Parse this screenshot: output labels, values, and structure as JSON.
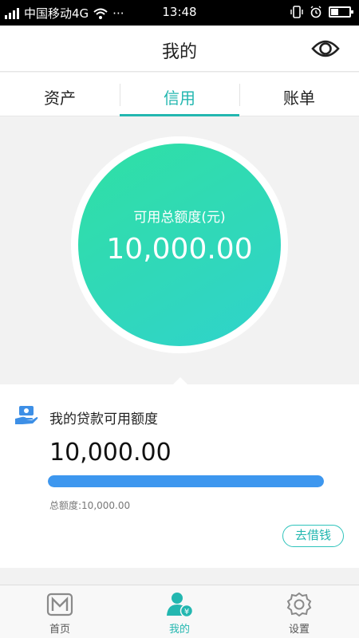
{
  "status_bar": {
    "carrier": "中国移动4G",
    "more": "···",
    "time": "13:48",
    "battery_level": 0.4
  },
  "header": {
    "title": "我的",
    "eye_icon": "eye-icon"
  },
  "tabs": [
    {
      "label": "资产",
      "active": false
    },
    {
      "label": "信用",
      "active": true
    },
    {
      "label": "账单",
      "active": false
    }
  ],
  "credit": {
    "label": "可用总额度(元)",
    "amount": "10,000.00"
  },
  "loan": {
    "title": "我的贷款可用额度",
    "amount": "10,000.00",
    "progress": 1.0,
    "total_text": "总额度:10,000.00",
    "borrow_button": "去借钱"
  },
  "bottom_nav": [
    {
      "label": "首页",
      "icon": "home-m-icon",
      "active": false
    },
    {
      "label": "我的",
      "icon": "profile-yuan-icon",
      "active": true
    },
    {
      "label": "设置",
      "icon": "gear-icon",
      "active": false
    }
  ],
  "colors": {
    "accent": "#23b7b0",
    "progress": "#3d97ef",
    "circle_start": "#2fe0a4",
    "circle_end": "#2fd3cc"
  }
}
